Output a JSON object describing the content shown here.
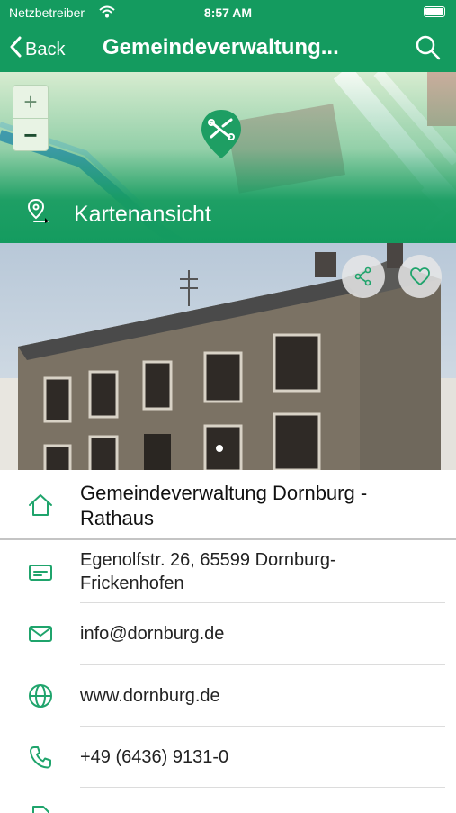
{
  "status_bar": {
    "carrier": "Netzbetreiber",
    "time": "8:57 AM"
  },
  "nav": {
    "back_label": "Back",
    "title": "Gemeindeverwaltung..."
  },
  "map": {
    "view_label": "Kartenansicht",
    "zoom_in": "+",
    "zoom_out": "−"
  },
  "detail": {
    "name": "Gemeindeverwaltung Dornburg - Rathaus",
    "address": "Egenolfstr. 26, 65599 Dornburg-Frickenhofen",
    "email": "info@dornburg.de",
    "website": "www.dornburg.de",
    "phone": "+49 (6436) 9131-0"
  },
  "colors": {
    "brand": "#149b5f",
    "icon": "#1fa46c"
  }
}
